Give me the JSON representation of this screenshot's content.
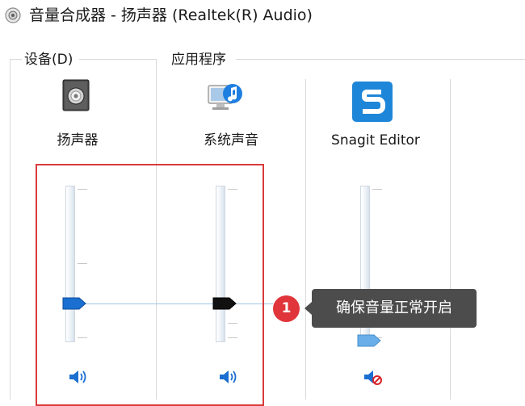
{
  "window": {
    "title": "音量合成器 - 扬声器 (Realtek(R) Audio)",
    "icon": "speaker-volume-icon"
  },
  "sections": {
    "device_label": "设备(D)",
    "apps_label": "应用程序"
  },
  "channels": [
    {
      "name": "扬声器",
      "icon": "speaker-device-icon",
      "volume": 0.24,
      "thumb_color": "#1a6fd1",
      "muted": false,
      "mute_icon": "speaker-sound-icon"
    },
    {
      "name": "系统声音",
      "icon": "system-sounds-icon",
      "volume": 0.24,
      "thumb_color": "#111111",
      "muted": false,
      "mute_icon": "speaker-sound-icon"
    },
    {
      "name": "Snagit Editor",
      "icon": "snagit-logo-icon",
      "volume": 0.0,
      "thumb_color": "#69aee8",
      "muted": true,
      "mute_icon": "speaker-muted-icon"
    }
  ],
  "annotation": {
    "badge_number": "1",
    "tooltip_text": "确保音量正常开启",
    "highlight_color": "#d93a3a"
  },
  "colors": {
    "accent_blue": "#1a6fd1",
    "tooltip_bg": "#4c4c4c",
    "badge_red": "#e0353a"
  }
}
